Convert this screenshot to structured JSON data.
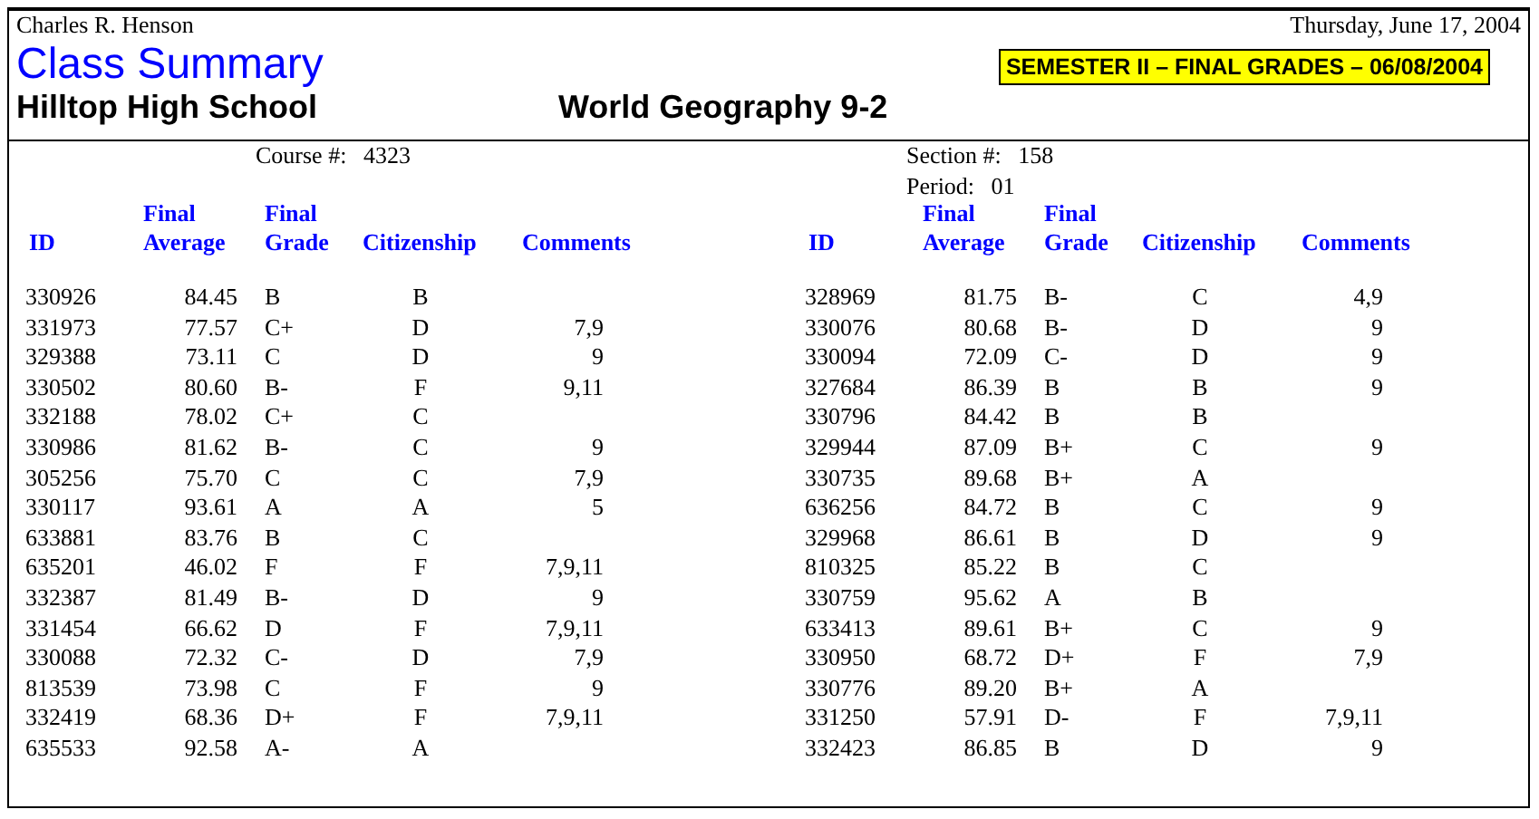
{
  "header": {
    "teacher": "Charles R. Henson",
    "date": "Thursday, June 17, 2004",
    "title": "Class Summary",
    "school": "Hilltop High School",
    "course_name": "World Geography 9-2",
    "semester_badge": "SEMESTER II – FINAL GRADES – 06/08/2004"
  },
  "course_info": {
    "course_label": "Course #:",
    "course_number": "4323",
    "section_label": "Section #:",
    "section_number": "158",
    "period_label": "Period:",
    "period": "01"
  },
  "tables": [
    {
      "columns": [
        "ID",
        "Final Average",
        "Final Grade",
        "Citizenship",
        "Comments"
      ],
      "rows": [
        {
          "id": "330926",
          "final_average": "84.45",
          "final_grade": "B",
          "citizenship": "B"
        },
        {
          "id": "331973",
          "final_average": "77.57",
          "final_grade": "C+",
          "citizenship": "D",
          "comments": "7,9"
        },
        {
          "id": "329388",
          "final_average": "73.11",
          "final_grade": "C",
          "citizenship": "D",
          "comments": "9"
        },
        {
          "id": "330502",
          "final_average": "80.60",
          "final_grade": "B-",
          "citizenship": "F",
          "comments": "9,11"
        },
        {
          "id": "332188",
          "final_average": "78.02",
          "final_grade": "C+",
          "citizenship": "C"
        },
        {
          "id": "330986",
          "final_average": "81.62",
          "final_grade": "B-",
          "citizenship": "C",
          "comments": "9"
        },
        {
          "id": "305256",
          "final_average": "75.70",
          "final_grade": "C",
          "citizenship": "C",
          "comments": "7,9"
        },
        {
          "id": "330117",
          "final_average": "93.61",
          "final_grade": "A",
          "citizenship": "A",
          "comments": "5"
        },
        {
          "id": "633881",
          "final_average": "83.76",
          "final_grade": "B",
          "citizenship": "C"
        },
        {
          "id": "635201",
          "final_average": "46.02",
          "final_grade": "F",
          "citizenship": "F",
          "comments": "7,9,11"
        },
        {
          "id": "332387",
          "final_average": "81.49",
          "final_grade": "B-",
          "citizenship": "D",
          "comments": "9"
        },
        {
          "id": "331454",
          "final_average": "66.62",
          "final_grade": "D",
          "citizenship": "F",
          "comments": "7,9,11"
        },
        {
          "id": "330088",
          "final_average": "72.32",
          "final_grade": "C-",
          "citizenship": "D",
          "comments": "7,9"
        },
        {
          "id": "813539",
          "final_average": "73.98",
          "final_grade": "C",
          "citizenship": "F",
          "comments": "9"
        },
        {
          "id": "332419",
          "final_average": "68.36",
          "final_grade": "D+",
          "citizenship": "F",
          "comments": "7,9,11"
        },
        {
          "id": "635533",
          "final_average": "92.58",
          "final_grade": "A-",
          "citizenship": "A"
        }
      ]
    },
    {
      "columns": [
        "ID",
        "Final Average",
        "Final Grade",
        "Citizenship",
        "Comments"
      ],
      "rows": [
        {
          "id": "328969",
          "final_average": "81.75",
          "final_grade": "B-",
          "citizenship": "C",
          "comments": "4,9"
        },
        {
          "id": "330076",
          "final_average": "80.68",
          "final_grade": "B-",
          "citizenship": "D",
          "comments": "9"
        },
        {
          "id": "330094",
          "final_average": "72.09",
          "final_grade": "C-",
          "citizenship": "D",
          "comments": "9"
        },
        {
          "id": "327684",
          "final_average": "86.39",
          "final_grade": "B",
          "citizenship": "B",
          "comments": "9"
        },
        {
          "id": "330796",
          "final_average": "84.42",
          "final_grade": "B",
          "citizenship": "B"
        },
        {
          "id": "329944",
          "final_average": "87.09",
          "final_grade": "B+",
          "citizenship": "C",
          "comments": "9"
        },
        {
          "id": "330735",
          "final_average": "89.68",
          "final_grade": "B+",
          "citizenship": "A"
        },
        {
          "id": "636256",
          "final_average": "84.72",
          "final_grade": "B",
          "citizenship": "C",
          "comments": "9"
        },
        {
          "id": "329968",
          "final_average": "86.61",
          "final_grade": "B",
          "citizenship": "D",
          "comments": "9"
        },
        {
          "id": "810325",
          "final_average": "85.22",
          "final_grade": "B",
          "citizenship": "C"
        },
        {
          "id": "330759",
          "final_average": "95.62",
          "final_grade": "A",
          "citizenship": "B"
        },
        {
          "id": "633413",
          "final_average": "89.61",
          "final_grade": "B+",
          "citizenship": "C",
          "comments": "9"
        },
        {
          "id": "330950",
          "final_average": "68.72",
          "final_grade": "D+",
          "citizenship": "F",
          "comments": "7,9"
        },
        {
          "id": "330776",
          "final_average": "89.20",
          "final_grade": "B+",
          "citizenship": "A"
        },
        {
          "id": "331250",
          "final_average": "57.91",
          "final_grade": "D-",
          "citizenship": "F",
          "comments": "7,9,11"
        },
        {
          "id": "332423",
          "final_average": "86.85",
          "final_grade": "B",
          "citizenship": "D",
          "comments": "9"
        }
      ]
    }
  ]
}
